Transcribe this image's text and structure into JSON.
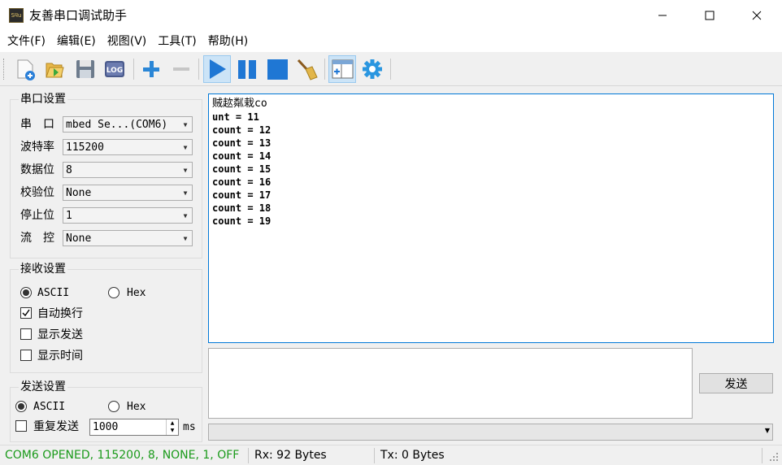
{
  "window": {
    "title": "友善串口调试助手",
    "icon_text": "Sपu"
  },
  "menu": [
    {
      "label": "文件(F)"
    },
    {
      "label": "编辑(E)"
    },
    {
      "label": "视图(V)"
    },
    {
      "label": "工具(T)"
    },
    {
      "label": "帮助(H)"
    }
  ],
  "toolbar": {
    "log_label": "LOG",
    "items": [
      "new-session-icon",
      "open-folder-icon",
      "save-icon",
      "log-icon",
      "add-icon",
      "remove-icon",
      "play-icon",
      "pause-icon",
      "stop-icon",
      "clear-broom-icon",
      "add-window-icon",
      "gear-icon"
    ]
  },
  "serial_settings": {
    "title": "串口设置",
    "port_label": "串　口",
    "port_value": "mbed Se...(COM6)",
    "baud_label": "波特率",
    "baud_value": "115200",
    "databits_label": "数据位",
    "databits_value": "8",
    "parity_label": "校验位",
    "parity_value": "None",
    "stopbits_label": "停止位",
    "stopbits_value": "1",
    "flow_label": "流　控",
    "flow_value": "None"
  },
  "receive_settings": {
    "title": "接收设置",
    "ascii_label": "ASCII",
    "hex_label": "Hex",
    "mode": "ASCII",
    "auto_wrap_label": "自动换行",
    "auto_wrap": true,
    "show_send_label": "显示发送",
    "show_send": false,
    "show_time_label": "显示时间",
    "show_time": false
  },
  "send_settings": {
    "title": "发送设置",
    "ascii_label": "ASCII",
    "hex_label": "Hex",
    "mode": "ASCII",
    "repeat_label": "重复发送",
    "repeat": false,
    "interval_value": "1000",
    "interval_unit": "ms"
  },
  "receive_text": [
    "贼趑粼栽co",
    "unt = 11",
    "count = 12",
    "count = 13",
    "count = 14",
    "count = 15",
    "count = 16",
    "count = 17",
    "count = 18",
    "count = 19"
  ],
  "send": {
    "text": "",
    "button_label": "发送"
  },
  "status": {
    "port_status": "COM6 OPENED, 115200, 8, NONE, 1, OFF",
    "rx": "Rx: 92 Bytes",
    "tx": "Tx: 0 Bytes"
  },
  "colors": {
    "status_ok": "#1a9a1a",
    "accent": "#0078d7",
    "toolbar_blue": "#1f77d4"
  }
}
